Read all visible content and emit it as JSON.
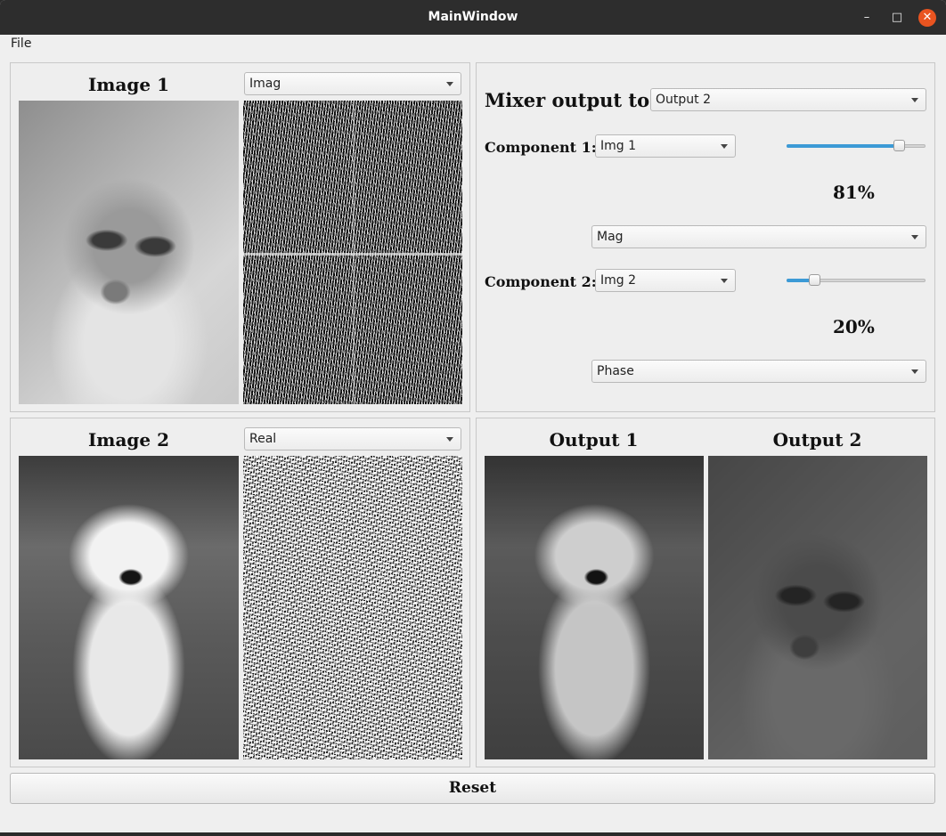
{
  "window": {
    "title": "MainWindow"
  },
  "titlebar": {
    "minimize_glyph": "–",
    "maximize_glyph": "□",
    "close_glyph": "✕"
  },
  "menu": {
    "file_label": "File"
  },
  "image1": {
    "heading": "Image 1",
    "component": "Imag"
  },
  "image2": {
    "heading": "Image 2",
    "component": "Real"
  },
  "mixer": {
    "output_label": "Mixer output to:",
    "output_value": "Output 2",
    "component1": {
      "label": "Component 1:",
      "image": "Img 1",
      "percent": 81,
      "percent_text": "81%",
      "mode": "Mag"
    },
    "component2": {
      "label": "Component 2:",
      "image": "Img 2",
      "percent": 20,
      "percent_text": "20%",
      "mode": "Phase"
    },
    "slider_accent": "#3c9ad6"
  },
  "outputs": {
    "output1_heading": "Output 1",
    "output2_heading": "Output 2"
  },
  "reset_label": "Reset",
  "colors": {
    "close_button": "#e95420",
    "titlebar": "#2d2d2d"
  }
}
